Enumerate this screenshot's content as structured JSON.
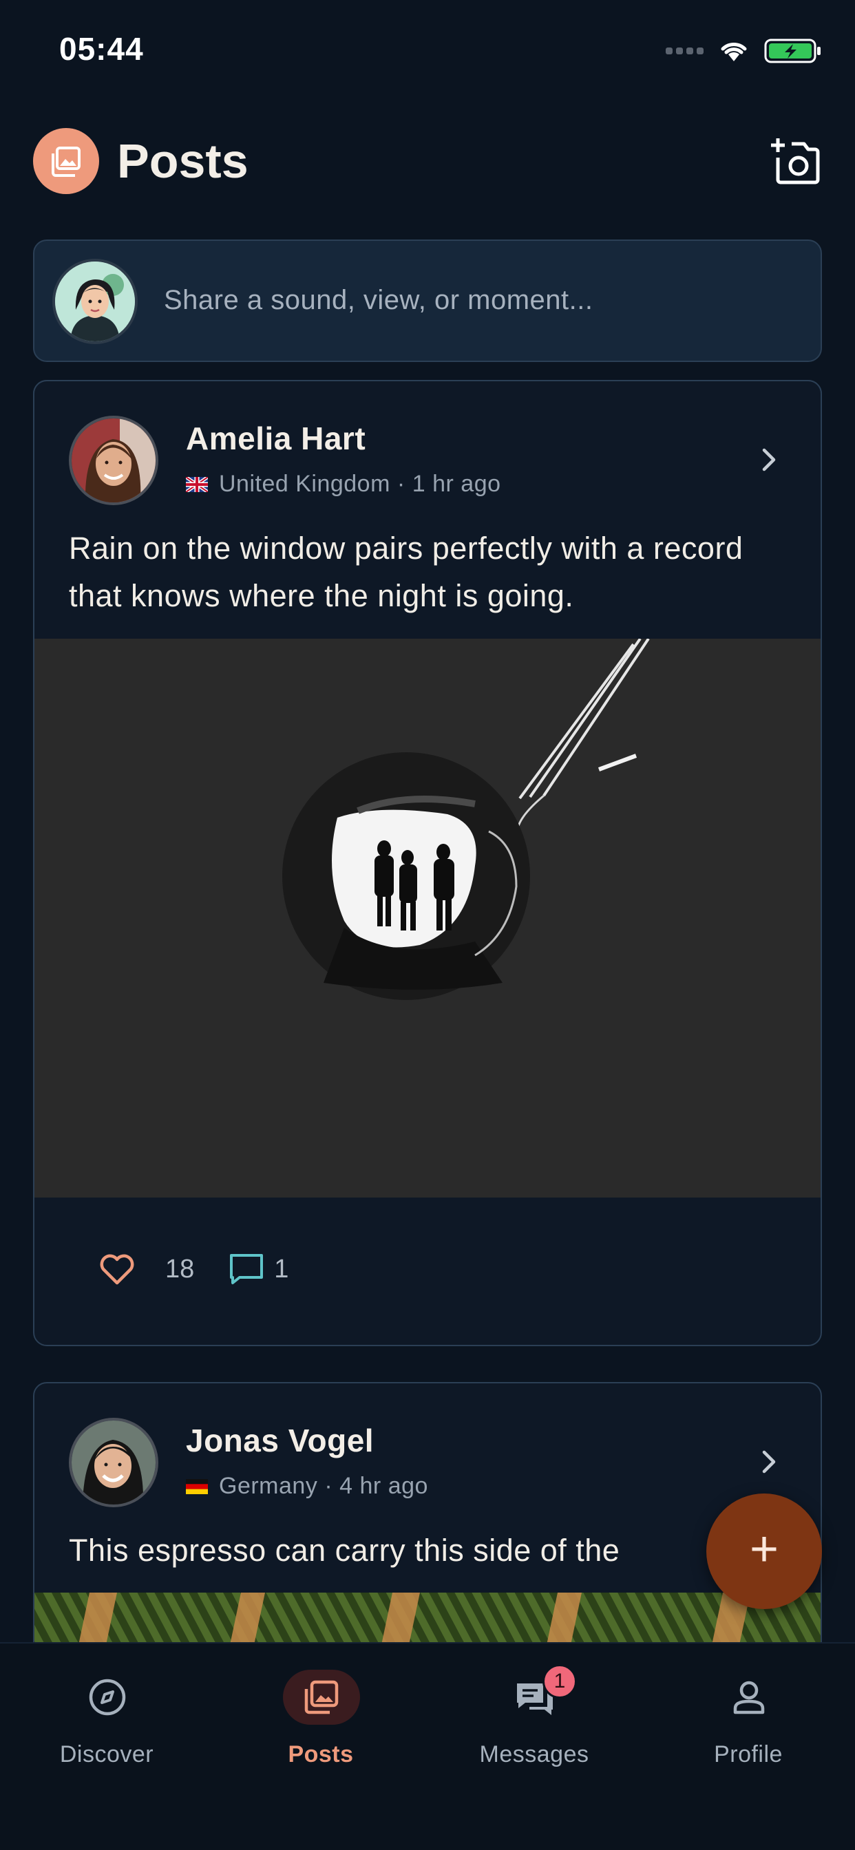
{
  "status_bar": {
    "time": "05:44"
  },
  "header": {
    "title": "Posts",
    "logo_icon": "gallery-icon",
    "action_icon": "add-photo-icon"
  },
  "composer": {
    "placeholder": "Share a sound, view, or moment..."
  },
  "posts": [
    {
      "author": "Amelia Hart",
      "country": "United Kingdom",
      "flag": "uk-flag",
      "time": "1 hr ago",
      "separator": "·",
      "text": "Rain on the window pairs perfectly with a record that knows where the night is going.",
      "likes": "18",
      "comments": "1"
    },
    {
      "author": "Jonas Vogel",
      "country": "Germany",
      "flag": "germany-flag",
      "time": "4 hr ago",
      "separator": "·",
      "text": "This espresso can carry this side of the"
    }
  ],
  "fab": {
    "label": "+"
  },
  "nav": {
    "items": [
      {
        "label": "Discover",
        "icon": "compass-icon"
      },
      {
        "label": "Posts",
        "icon": "gallery-icon",
        "active": true
      },
      {
        "label": "Messages",
        "icon": "chat-icon",
        "badge": "1"
      },
      {
        "label": "Profile",
        "icon": "person-icon"
      }
    ]
  },
  "colors": {
    "background": "#0b1420",
    "accent": "#ee9a7c",
    "fab": "#7e3513",
    "badge": "#f0687a",
    "comment_icon": "#5fc4c9"
  }
}
